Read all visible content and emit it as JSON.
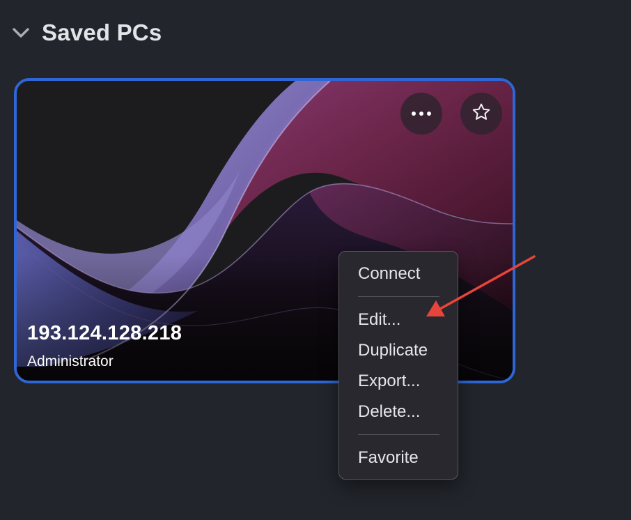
{
  "section": {
    "title": "Saved PCs",
    "collapse_icon": "chevron-down-icon"
  },
  "pc_card": {
    "title": "193.124.128.218",
    "subtitle": "Administrator",
    "selected": true,
    "accent_color": "#2f66d6",
    "more_icon": "ellipsis-icon",
    "favorite_icon": "star-outline-icon"
  },
  "context_menu": {
    "items": [
      {
        "label": "Connect"
      },
      {
        "label": "Edit..."
      },
      {
        "label": "Duplicate"
      },
      {
        "label": "Export..."
      },
      {
        "label": "Delete..."
      },
      {
        "label": "Favorite"
      }
    ]
  },
  "annotation": {
    "arrow_color": "#e8453a",
    "points_to": "Edit..."
  },
  "colors": {
    "background": "#22252c",
    "menu_background": "#29282e",
    "text": "#e6e6ea"
  }
}
